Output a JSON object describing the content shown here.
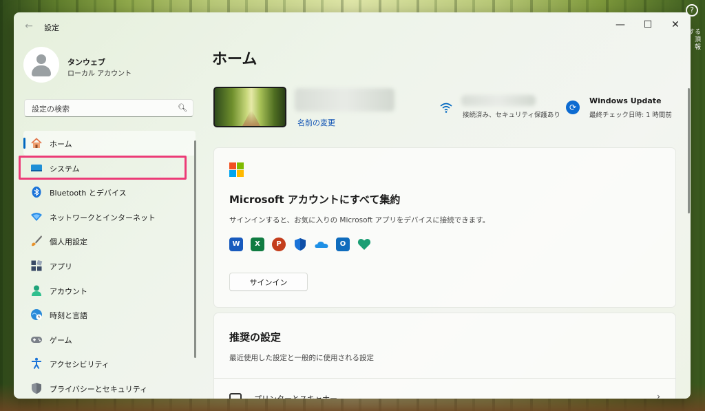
{
  "desktop": {
    "corner_text": "]する\n頂\n報"
  },
  "window": {
    "title": "設定",
    "controls": {
      "minimize": "—",
      "maximize": "☐",
      "close": "✕"
    }
  },
  "profile": {
    "name": "タンウェブ",
    "account_type": "ローカル アカウント"
  },
  "search": {
    "placeholder": "設定の検索"
  },
  "sidebar": {
    "items": [
      {
        "label": "ホーム",
        "icon": "home-icon",
        "active": true
      },
      {
        "label": "システム",
        "icon": "system-icon"
      },
      {
        "label": "Bluetooth とデバイス",
        "icon": "bluetooth-icon"
      },
      {
        "label": "ネットワークとインターネット",
        "icon": "network-icon"
      },
      {
        "label": "個人用設定",
        "icon": "brush-icon"
      },
      {
        "label": "アプリ",
        "icon": "apps-icon"
      },
      {
        "label": "アカウント",
        "icon": "account-icon"
      },
      {
        "label": "時刻と言語",
        "icon": "time-language-icon"
      },
      {
        "label": "ゲーム",
        "icon": "gamepad-icon"
      },
      {
        "label": "アクセシビリティ",
        "icon": "accessibility-icon"
      },
      {
        "label": "プライバシーとセキュリティ",
        "icon": "shield-icon"
      }
    ],
    "highlighted_item": "システム",
    "highlight_color": "#ec3b77"
  },
  "main": {
    "title": "ホーム",
    "device": {
      "rename_link": "名前の変更"
    },
    "network": {
      "status": "接続済み、セキュリティ保護あり"
    },
    "update": {
      "title": "Windows Update",
      "last_checked": "最終チェック日時: 1 時間前"
    },
    "ms_card": {
      "title": "Microsoft アカウントにすべて集約",
      "description": "サインインすると、お気に入りの Microsoft アプリをデバイスに接続できます。",
      "apps": [
        "word-icon",
        "excel-icon",
        "powerpoint-icon",
        "defender-icon",
        "onedrive-icon",
        "outlook-icon",
        "family-icon"
      ],
      "signin_label": "サインイン"
    },
    "recommended": {
      "title": "推奨の設定",
      "description": "最近使用した設定と一般的に使用される設定",
      "first_row_label": "プリンターとスキャナー"
    }
  },
  "colors": {
    "accent": "#0067c0",
    "link": "#0a4fb3"
  }
}
